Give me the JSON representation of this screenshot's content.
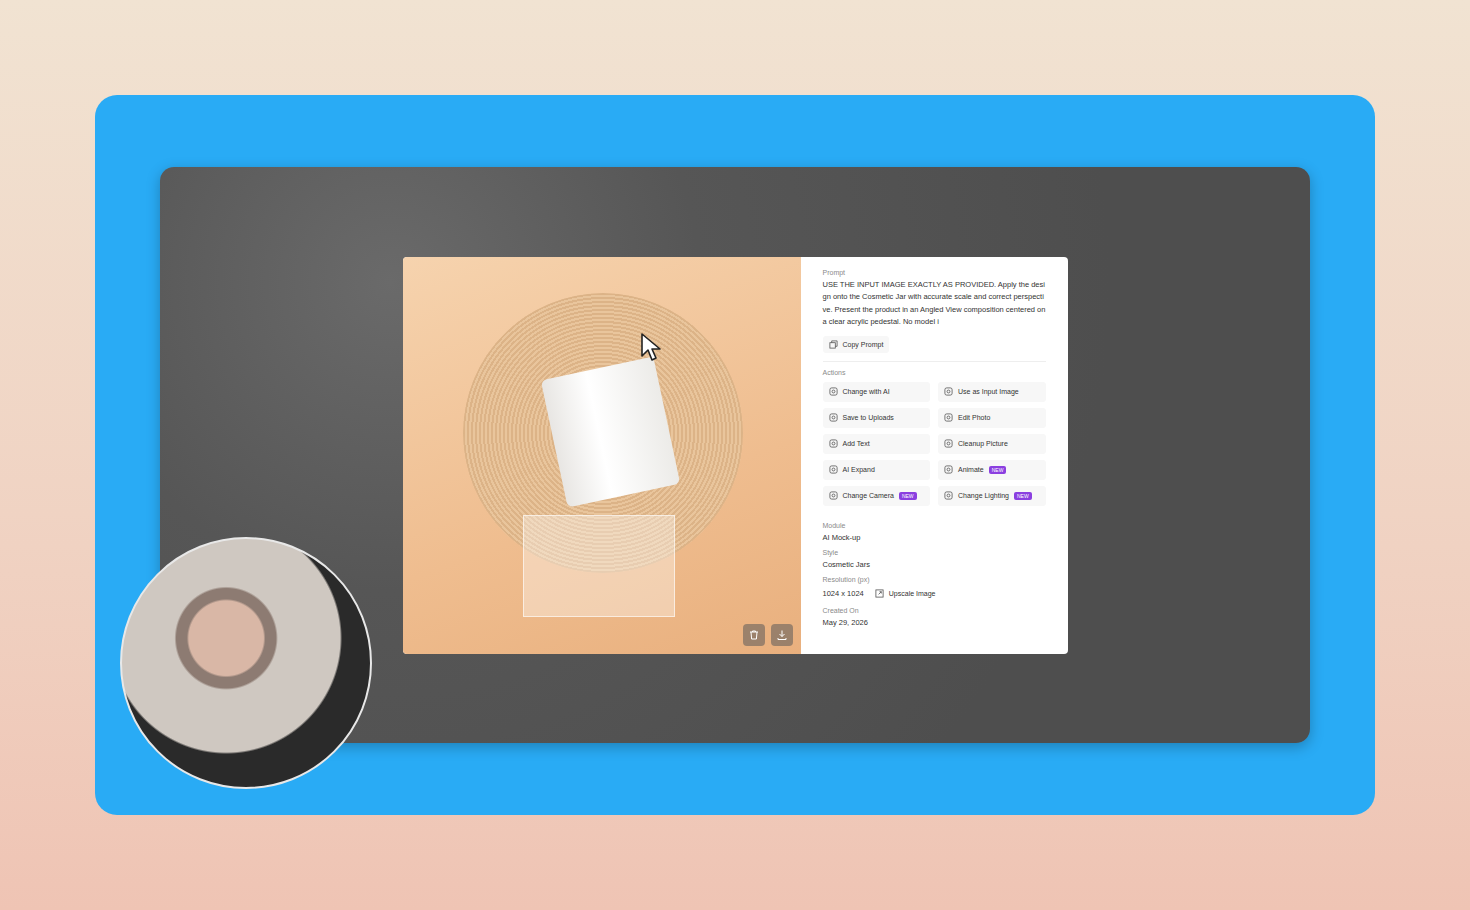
{
  "prompt": {
    "label": "Prompt",
    "text": "USE THE INPUT IMAGE EXACTLY AS PROVIDED. Apply the design onto the Cosmetic Jar with accurate scale and correct perspective. Present the product in an Angled View composition centered on a clear acrylic pedestal. No model i",
    "copy_button": "Copy Prompt"
  },
  "actions": {
    "label": "Actions",
    "items": [
      {
        "label": "Change with AI"
      },
      {
        "label": "Use as Input Image"
      },
      {
        "label": "Save to Uploads"
      },
      {
        "label": "Edit Photo"
      },
      {
        "label": "Add Text"
      },
      {
        "label": "Cleanup Picture"
      },
      {
        "label": "AI Expand"
      },
      {
        "label": "Animate",
        "badge": "NEW"
      },
      {
        "label": "Change Camera",
        "badge": "NEW"
      },
      {
        "label": "Change Lighting",
        "badge": "NEW"
      }
    ]
  },
  "details": [
    {
      "label": "Module",
      "value": "AI Mock-up"
    },
    {
      "label": "Style",
      "value": "Cosmetic Jars"
    },
    {
      "label": "Resolution (px)",
      "value": "1024 x 1024",
      "action": "Upscale Image"
    },
    {
      "label": "Created On",
      "value": "May 29, 2026"
    }
  ]
}
